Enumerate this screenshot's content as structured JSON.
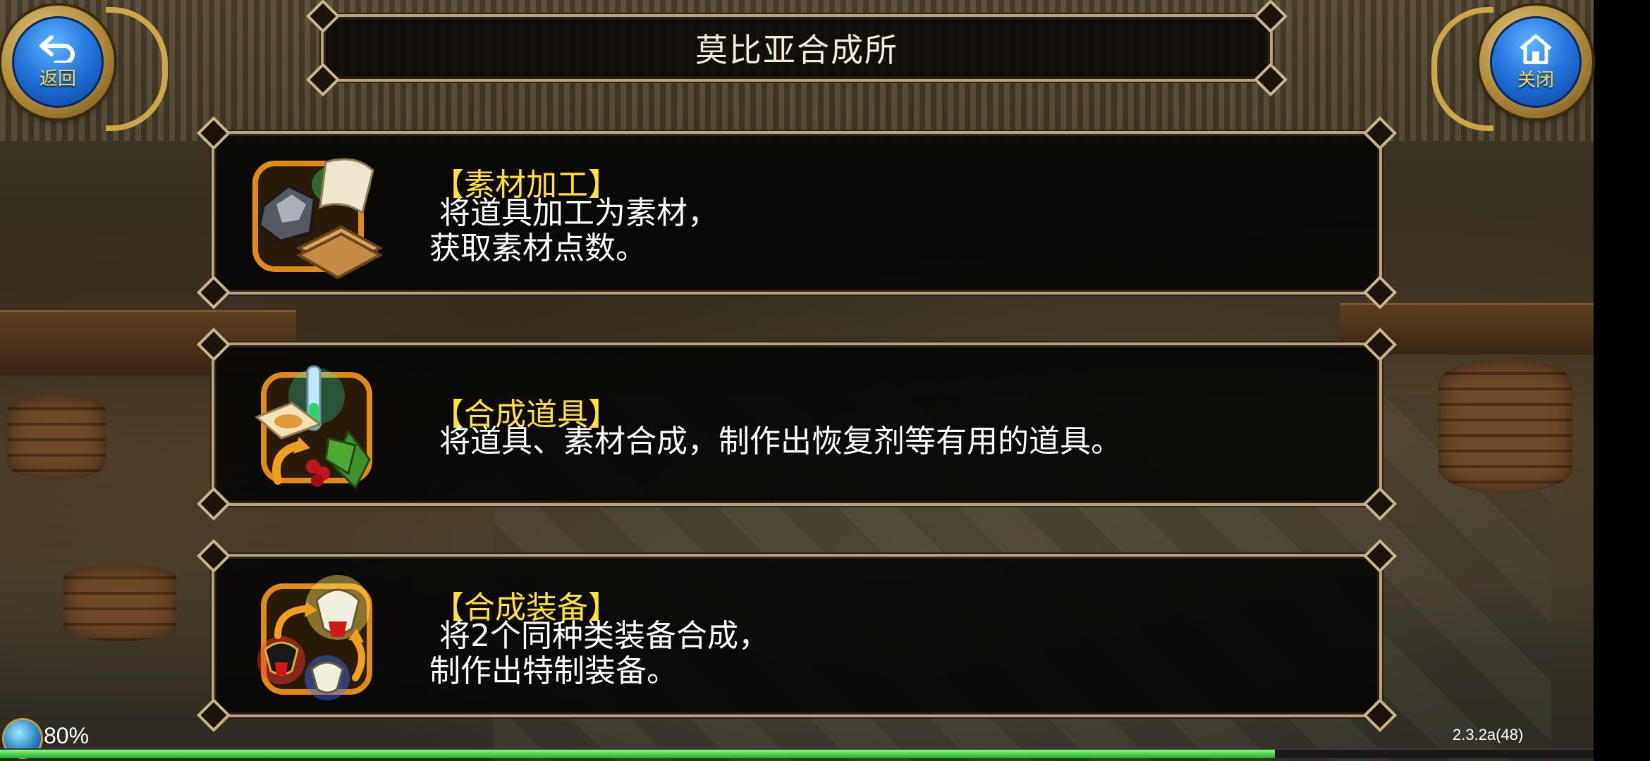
{
  "header": {
    "title": "莫比亚合成所",
    "back_label": "返回",
    "close_label": "关闭"
  },
  "menu": [
    {
      "title": "【素材加工】",
      "desc": " 将道具加工为素材，\n获取素材点数。",
      "icon": "materials-icon"
    },
    {
      "title": "【合成道具】",
      "desc": " 将道具、素材合成，制作出恢复剂等有用的道具。",
      "icon": "potion-herb-icon"
    },
    {
      "title": "【合成装备】",
      "desc": " 将2个同种类装备合成，\n制作出特制装备。",
      "icon": "equipment-fusion-icon"
    }
  ],
  "status": {
    "loading_percent": "80%",
    "loading_value": 0.8,
    "version": "2.3.2a(48)"
  },
  "colors": {
    "title_gold": "#ffe23a",
    "frame": "#b9a27d",
    "button_blue": "#1f6fd6",
    "progress_green": "#3bd43b"
  }
}
